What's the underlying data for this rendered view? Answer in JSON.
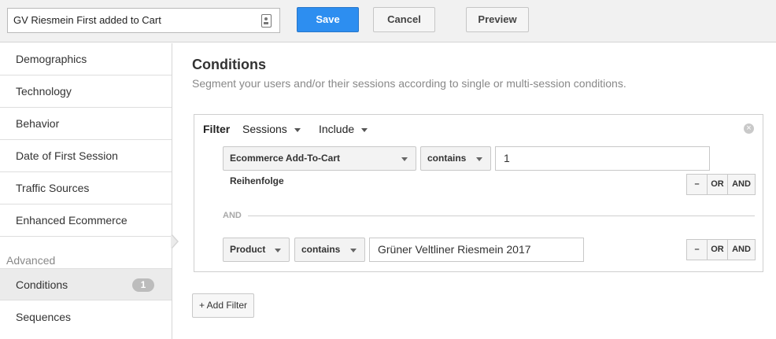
{
  "header": {
    "segment_name": "GV Riesmein First added to Cart",
    "save_label": "Save",
    "cancel_label": "Cancel",
    "preview_label": "Preview"
  },
  "sidebar": {
    "items": [
      {
        "label": "Demographics"
      },
      {
        "label": "Technology"
      },
      {
        "label": "Behavior"
      },
      {
        "label": "Date of First Session"
      },
      {
        "label": "Traffic Sources"
      },
      {
        "label": "Enhanced Ecommerce"
      }
    ],
    "advanced_label": "Advanced",
    "advanced_items": [
      {
        "label": "Conditions",
        "badge": "1",
        "active": true
      },
      {
        "label": "Sequences"
      }
    ]
  },
  "main": {
    "title": "Conditions",
    "subtitle": "Segment your users and/or their sessions according to single or multi-session conditions.",
    "filter": {
      "label": "Filter",
      "scope": "Sessions",
      "mode": "Include",
      "rows": [
        {
          "dimension": "Ecommerce Add-To-Cart Reihenfolge",
          "operator": "contains",
          "value": "1"
        },
        {
          "dimension": "Product",
          "operator": "contains",
          "value": "Grüner Veltliner Riesmein 2017"
        }
      ],
      "and_separator": "AND",
      "minus_label": "–",
      "or_label": "OR",
      "and_label": "AND"
    },
    "add_filter_label": "+ Add Filter"
  },
  "colors": {
    "save_blue": "#2d8ef0",
    "active_bg": "#ebebeb",
    "badge_gray": "#bcbcbc"
  }
}
